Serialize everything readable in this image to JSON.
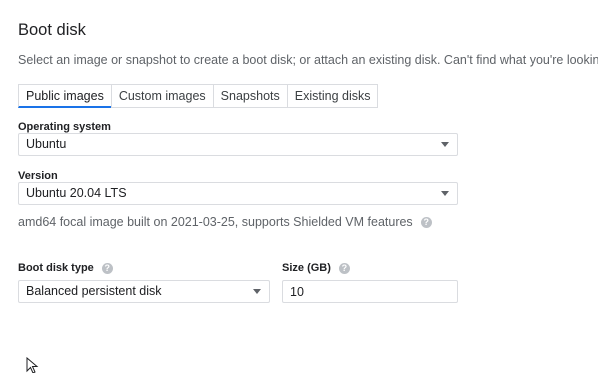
{
  "section": {
    "title": "Boot disk",
    "description": "Select an image or snapshot to create a boot disk; or attach an existing disk. Can't find what you're looking for"
  },
  "tabs": [
    {
      "label": "Public images",
      "active": true
    },
    {
      "label": "Custom images",
      "active": false
    },
    {
      "label": "Snapshots",
      "active": false
    },
    {
      "label": "Existing disks",
      "active": false
    }
  ],
  "os": {
    "label": "Operating system",
    "value": "Ubuntu"
  },
  "version": {
    "label": "Version",
    "value": "Ubuntu 20.04 LTS",
    "info": "amd64 focal image built on 2021-03-25, supports Shielded VM features"
  },
  "disk_type": {
    "label": "Boot disk type",
    "value": "Balanced persistent disk"
  },
  "size": {
    "label": "Size (GB)",
    "value": "10"
  },
  "icons": {
    "help": "help-circle-icon",
    "dropdown": "chevron-down-icon",
    "cursor": "mouse-pointer-icon"
  },
  "colors": {
    "accent": "#1a73e8",
    "border": "#dadce0",
    "secondary_text": "#5f6368",
    "help_icon": "#bdc1c6"
  }
}
